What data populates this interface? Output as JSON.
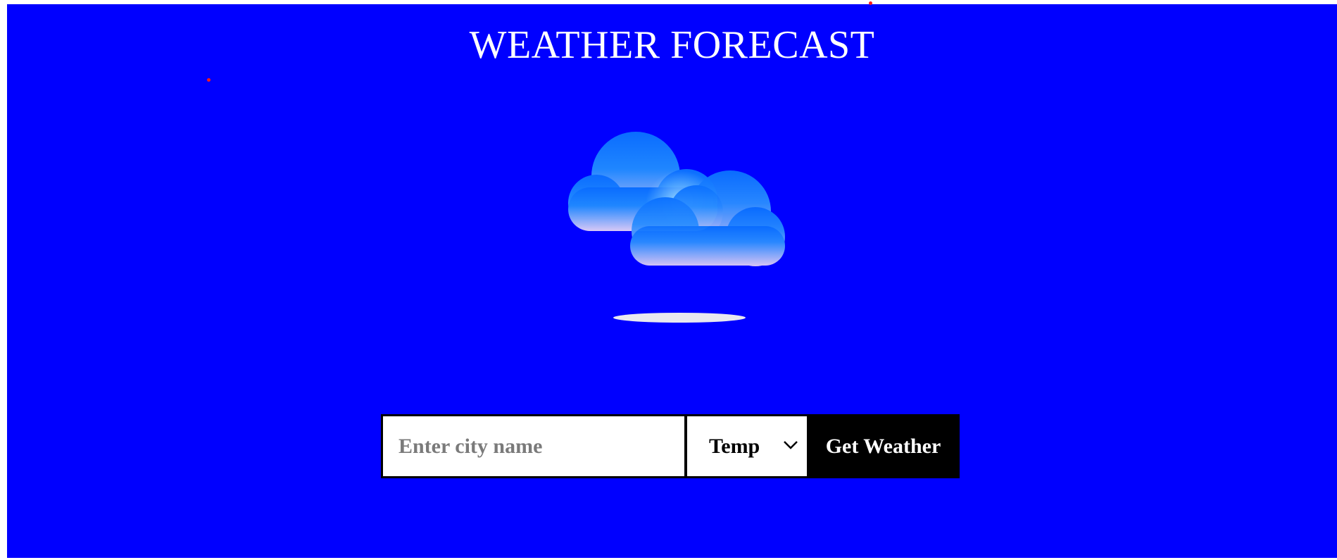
{
  "page": {
    "title": "WEATHER FORECAST",
    "background_color": "#0000ff"
  },
  "illustration": {
    "icon": "clouds-icon",
    "shadow_icon": "shadow-ellipse"
  },
  "search": {
    "city_placeholder": "Enter city name",
    "city_value": "",
    "unit_selected": "Temp",
    "unit_icon": "chevron-down-icon",
    "submit_label": "Get Weather"
  },
  "colors": {
    "accent": "#0000ff",
    "text": "#ffffff",
    "button_bg": "#000000",
    "cloud_top": "#0a72ff",
    "cloud_bottom": "#d8c8f6",
    "marker_dot": "#ff1a1a"
  }
}
